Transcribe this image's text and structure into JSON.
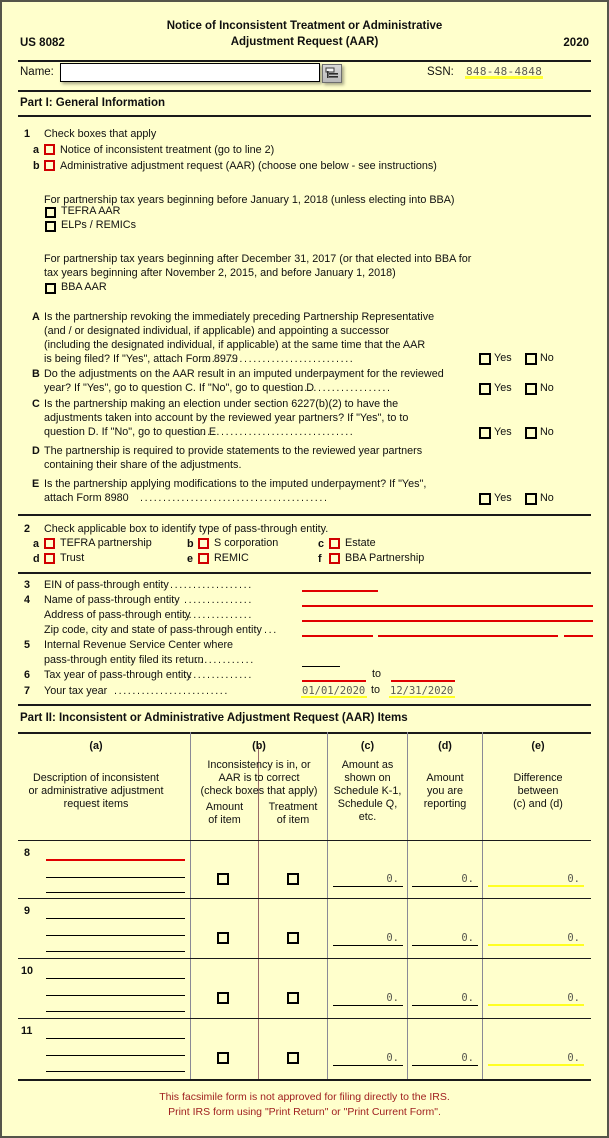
{
  "header": {
    "title_line1": "Notice of Inconsistent Treatment or Administrative",
    "title_line2": "Adjustment Request  (AAR)",
    "form_id": "US 8082",
    "year": "2020"
  },
  "name_row": {
    "name_label": "Name:",
    "name_value": "",
    "name_placeholder": "",
    "picker_icon": "list-picker-icon",
    "ssn_label": "SSN:",
    "ssn_value": "848-48-4848"
  },
  "part1": {
    "heading": "Part I:  General Information",
    "line1": {
      "number": "1",
      "text": "Check boxes that apply",
      "a_letter": "a",
      "a_text": "Notice of inconsistent treatment  (go to line 2)",
      "b_letter": "b",
      "b_text": "Administrative adjustment request  (AAR)  (choose one below - see instructions)"
    },
    "group1_caption": "For partnership tax years beginning before January 1, 2018  (unless electing into BBA)",
    "group1_options": [
      "TEFRA AAR",
      "ELPs / REMICs"
    ],
    "group2_caption_line1": "For partnership tax years beginning after December 31, 2017  (or that elected into BBA for",
    "group2_caption_line2": "tax years beginning after November 2, 2015,  and before January 1, 2018)",
    "group2_options": [
      "BBA AAR"
    ],
    "questions": [
      {
        "letter": "A",
        "lines": [
          "Is the partnership revoking the immediately preceding Partnership Representative",
          "(and / or designated individual,  if applicable)  and appointing a successor",
          "(including the designated individual,  if applicable)  at the same time that the AAR",
          "is being filed?  If  \"Yes\",  attach Form 8979"
        ],
        "yes_label": "Yes",
        "no_label": "No",
        "has_answer_boxes": true
      },
      {
        "letter": "B",
        "lines": [
          "Do the adjustments on the AAR result in an imputed underpayment for the reviewed",
          "year?  If  \"Yes\",  go to question C.  If  \"No\",  go to question D"
        ],
        "yes_label": "Yes",
        "no_label": "No",
        "has_answer_boxes": true
      },
      {
        "letter": "C",
        "lines": [
          "Is the partnership making an election under section 6227(b)(2)  to have the",
          "adjustments taken into account by the reviewed year partners?  If  \"Yes\",  to to",
          "question D.  If  \"No\",  go to question E"
        ],
        "yes_label": "Yes",
        "no_label": "No",
        "has_answer_boxes": true
      },
      {
        "letter": "D",
        "lines": [
          "The partnership is required to provide statements to the reviewed year partners",
          "containing their share of the adjustments."
        ],
        "has_answer_boxes": false
      },
      {
        "letter": "E",
        "lines": [
          "Is the partnership applying modifications to the imputed underpayment?  If  \"Yes\",",
          "attach Form 8980"
        ],
        "yes_label": "Yes",
        "no_label": "No",
        "has_answer_boxes": true
      }
    ],
    "line2": {
      "number": "2",
      "text": "Check applicable box to identify type of pass-through entity.",
      "options": [
        {
          "letter": "a",
          "label": "TEFRA partnership"
        },
        {
          "letter": "b",
          "label": "S corporation"
        },
        {
          "letter": "c",
          "label": "Estate"
        },
        {
          "letter": "d",
          "label": "Trust"
        },
        {
          "letter": "e",
          "label": "REMIC"
        },
        {
          "letter": "f",
          "label": "BBA Partnership"
        }
      ]
    },
    "lines_3_7": [
      {
        "number": "3",
        "label": "EIN of pass-through entity",
        "value": ""
      },
      {
        "number": "4",
        "label": "Name of pass-through entity",
        "value": ""
      },
      {
        "number": "",
        "label": "Address of pass-through entity",
        "value": ""
      },
      {
        "number": "",
        "label": "Zip code,  city and state of pass-through entity",
        "value": ""
      },
      {
        "number": "5",
        "label_line1": "Internal Revenue Service Center where",
        "label_line2": "pass-through entity filed its return",
        "value": ""
      },
      {
        "number": "6",
        "label": "Tax year of pass-through entity",
        "value_from": "",
        "separator": "to",
        "value_to": ""
      },
      {
        "number": "7",
        "label": "Your tax year",
        "value_from": "01/01/2020",
        "separator": "to",
        "value_to": "12/31/2020"
      }
    ]
  },
  "part2": {
    "heading": "Part II:  Inconsistent or Administrative Adjustment Request  (AAR)  Items",
    "columns": [
      {
        "tag": "(a)",
        "lines": [
          "Description of inconsistent",
          "or administrative adjustment",
          "request items"
        ]
      },
      {
        "tag": "(b)",
        "lines": [
          "Inconsistency is in,  or",
          "AAR is to correct",
          "(check boxes that apply)"
        ],
        "sub": [
          [
            "Amount",
            "of item"
          ],
          [
            "Treatment",
            "of item"
          ]
        ]
      },
      {
        "tag": "(c)",
        "lines": [
          "Amount as",
          "shown on",
          "Schedule K-1,",
          "Schedule Q,",
          "etc."
        ]
      },
      {
        "tag": "(d)",
        "lines": [
          "Amount",
          "you are",
          "reporting"
        ]
      },
      {
        "tag": "(e)",
        "lines": [
          "Difference",
          "between",
          "(c)  and  (d)"
        ]
      }
    ],
    "rows": [
      {
        "number": "8",
        "description": "",
        "first_line_required": true,
        "amount_checked": false,
        "treatment_checked": false,
        "c": "0.",
        "d": "0.",
        "e": "0."
      },
      {
        "number": "9",
        "description": "",
        "first_line_required": false,
        "amount_checked": false,
        "treatment_checked": false,
        "c": "0.",
        "d": "0.",
        "e": "0."
      },
      {
        "number": "10",
        "description": "",
        "first_line_required": false,
        "amount_checked": false,
        "treatment_checked": false,
        "c": "0.",
        "d": "0.",
        "e": "0."
      },
      {
        "number": "11",
        "description": "",
        "first_line_required": false,
        "amount_checked": false,
        "treatment_checked": false,
        "c": "0.",
        "d": "0.",
        "e": "0."
      }
    ]
  },
  "footer": {
    "line1": "This facsimile form is not approved for filing directly to the IRS.",
    "line2": "Print IRS form using \"Print Return\" or \"Print Current Form\"."
  },
  "colors": {
    "page_background": "#FFFFCC",
    "required_field": "#E00000",
    "highlight": "#FFFF22",
    "footer_text": "#A02020",
    "entry_text": "#5A5A52"
  }
}
